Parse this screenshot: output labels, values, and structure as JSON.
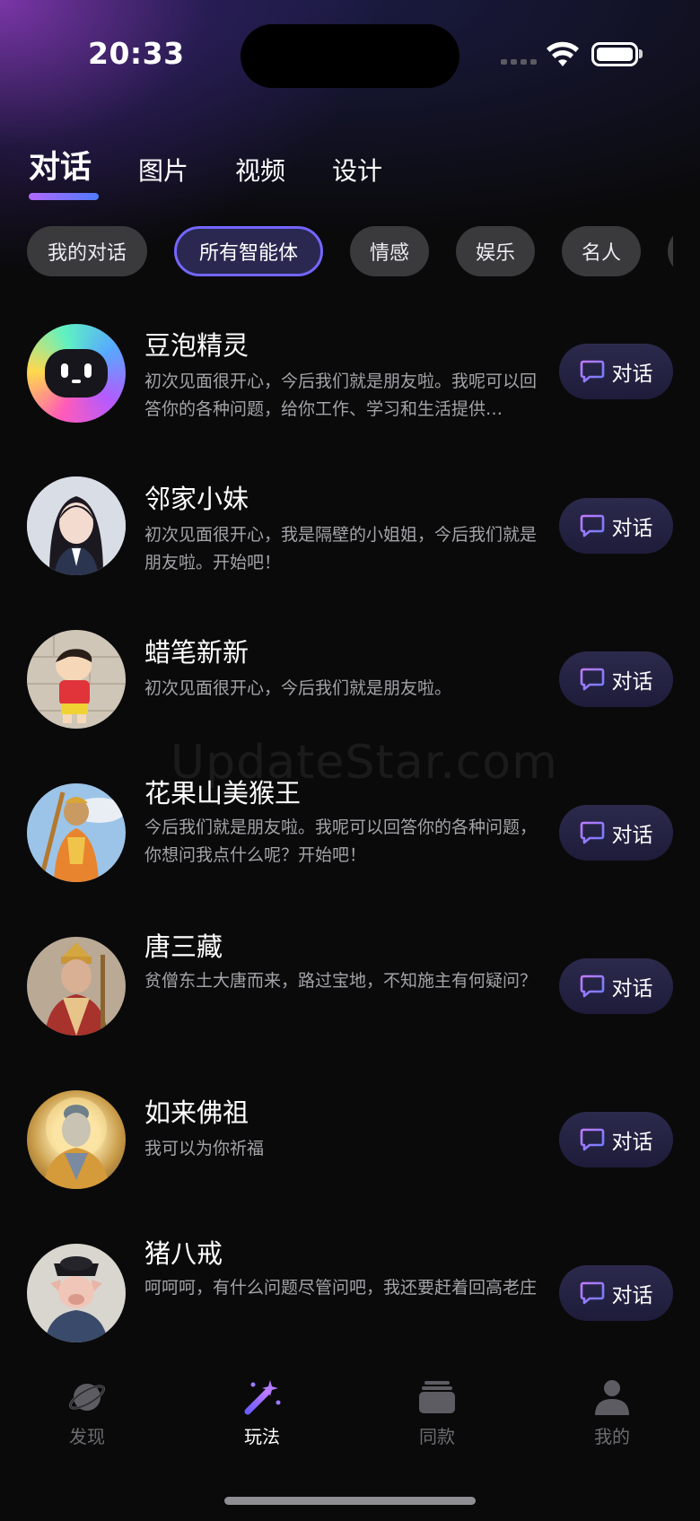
{
  "status_bar": {
    "time": "20:33"
  },
  "top_tabs": [
    {
      "label": "对话",
      "active": true
    },
    {
      "label": "图片",
      "active": false
    },
    {
      "label": "视频",
      "active": false
    },
    {
      "label": "设计",
      "active": false
    }
  ],
  "chips": [
    {
      "label": "我的对话",
      "active": false
    },
    {
      "label": "所有智能体",
      "active": true
    },
    {
      "label": "情感",
      "active": false
    },
    {
      "label": "娱乐",
      "active": false
    },
    {
      "label": "名人",
      "active": false
    },
    {
      "label": "",
      "active": false
    }
  ],
  "agents": [
    {
      "name": "豆泡精灵",
      "desc": "初次见面很开心，今后我们就是朋友啦。我呢可以回答你的各种问题，给你工作、学习和生活提供…",
      "button": "对话"
    },
    {
      "name": "邻家小妹",
      "desc": "初次见面很开心，我是隔壁的小姐姐，今后我们就是朋友啦。开始吧！",
      "button": "对话"
    },
    {
      "name": "蜡笔新新",
      "desc": "初次见面很开心，今后我们就是朋友啦。",
      "button": "对话"
    },
    {
      "name": "花果山美猴王",
      "desc": "今后我们就是朋友啦。我呢可以回答你的各种问题，你想问我点什么呢？开始吧！",
      "button": "对话"
    },
    {
      "name": "唐三藏",
      "desc": "贫僧东土大唐而来，路过宝地，不知施主有何疑问？",
      "button": "对话"
    },
    {
      "name": "如来佛祖",
      "desc": "我可以为你祈福",
      "button": "对话"
    },
    {
      "name": "猪八戒",
      "desc": "呵呵呵，有什么问题尽管问吧，我还要赶着回高老庄",
      "button": "对话"
    }
  ],
  "watermark": "UpdateStar.com",
  "bottom_nav": [
    {
      "label": "发现",
      "icon": "planet-icon",
      "active": false
    },
    {
      "label": "玩法",
      "icon": "magic-wand-icon",
      "active": true
    },
    {
      "label": "同款",
      "icon": "stack-icon",
      "active": false
    },
    {
      "label": "我的",
      "icon": "person-icon",
      "active": false
    }
  ],
  "colors": {
    "accent": "#7466ff",
    "chip_bg": "#3a3a3d",
    "button_bg": "#25233f",
    "text_secondary": "#a3a3a8"
  }
}
